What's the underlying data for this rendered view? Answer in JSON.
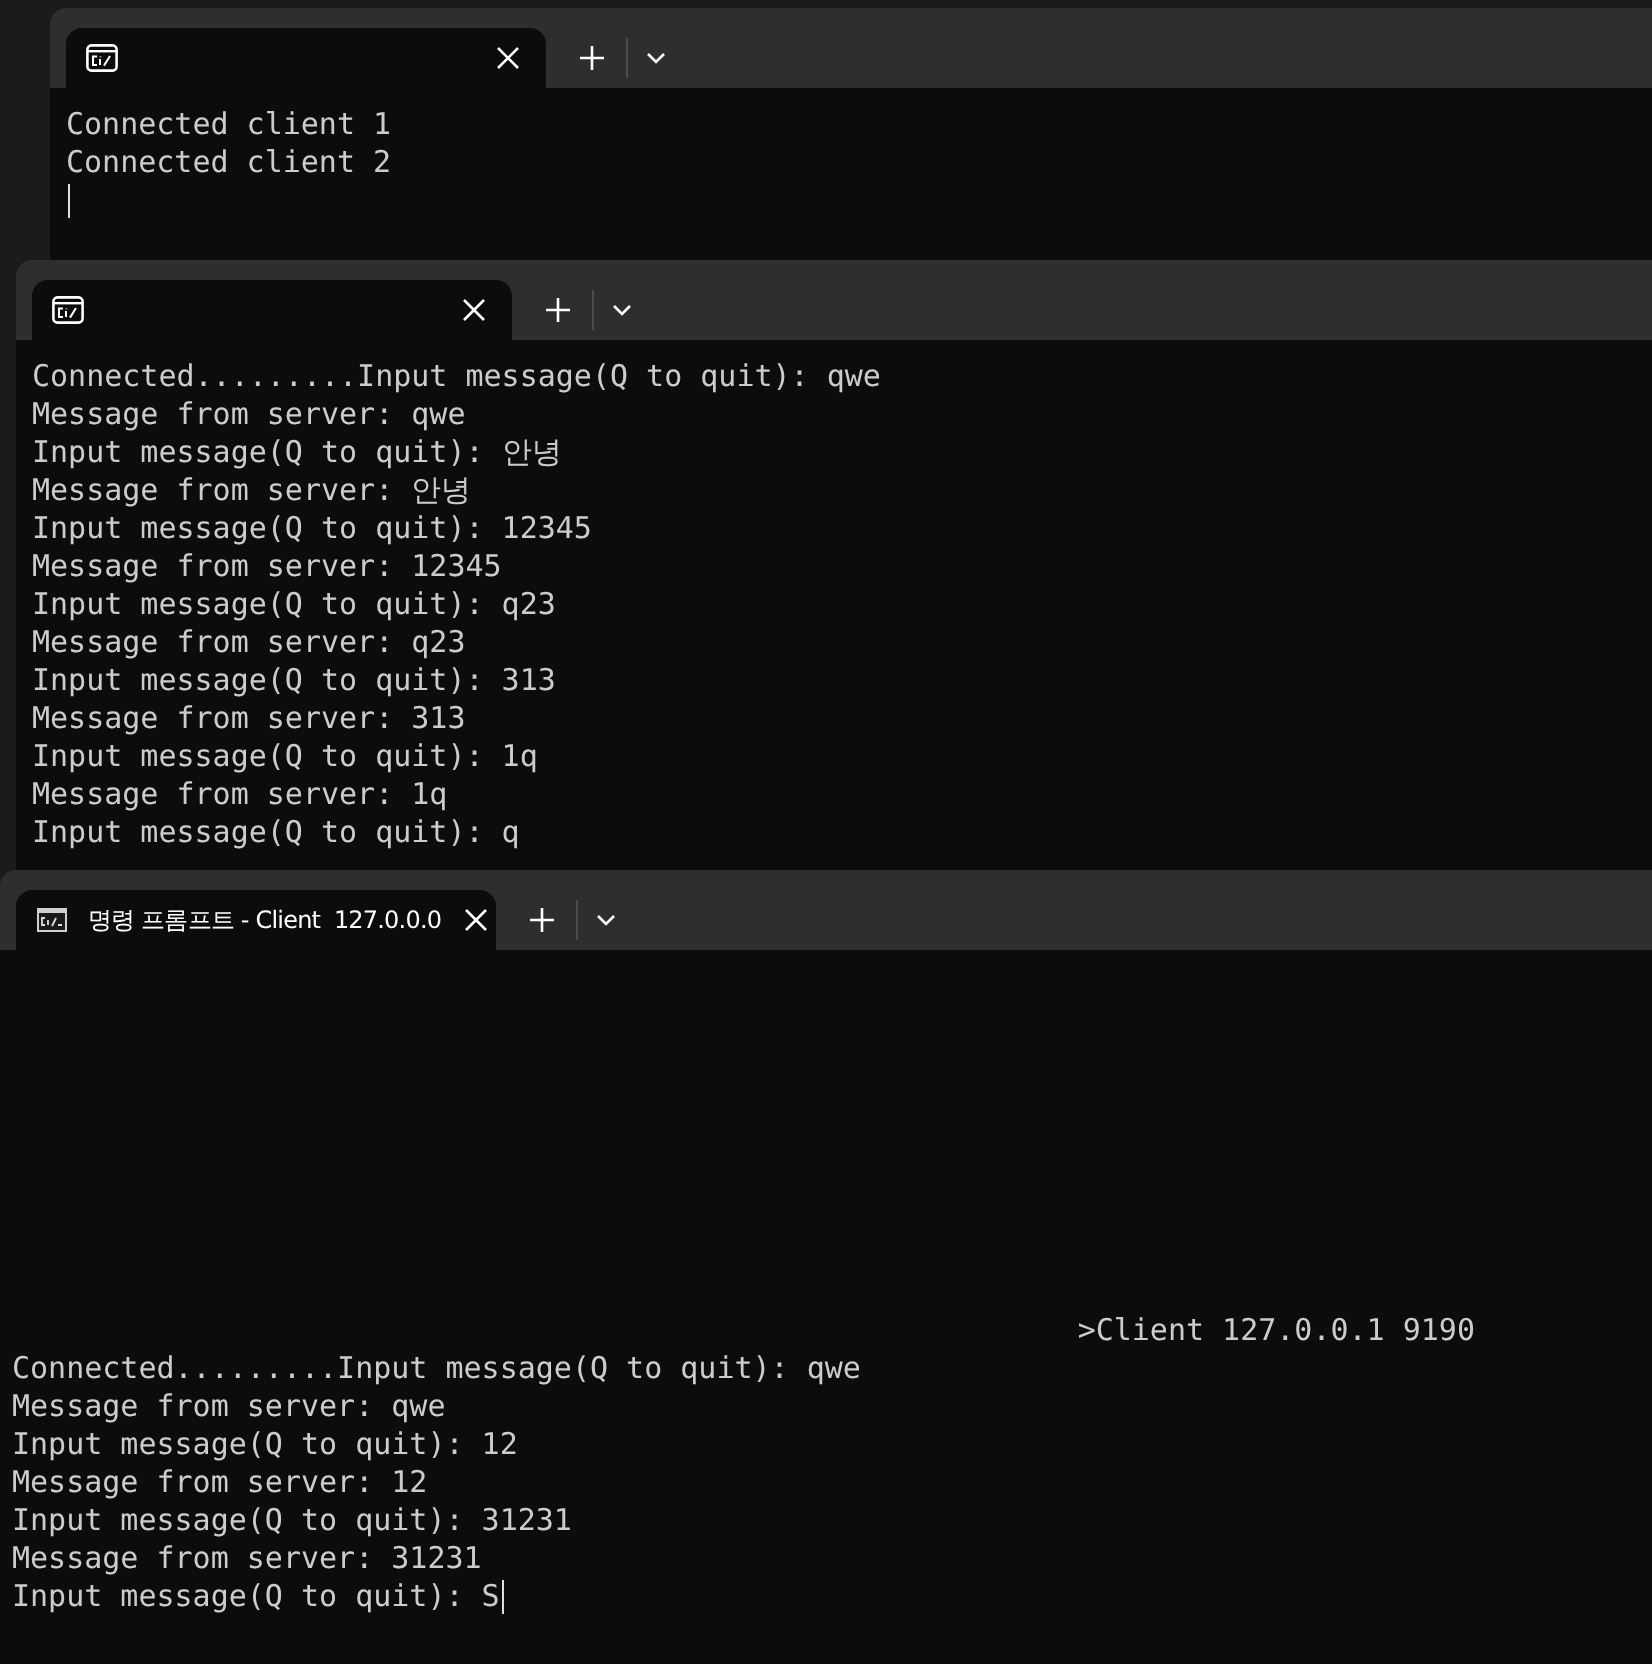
{
  "windows": [
    {
      "tab": {
        "selected": true
      },
      "lines": [
        {
          "kind": "output",
          "text": "Connected client 1",
          "cursor": false
        },
        {
          "kind": "output",
          "text": "Connected client 2",
          "cursor": false
        },
        {
          "kind": "blank",
          "cursor": true
        }
      ]
    },
    {
      "tab": {
        "selected": true
      },
      "lines": [
        {
          "kind": "output",
          "text": "Connected.........Input message(Q to quit): qwe",
          "cursor": false
        },
        {
          "kind": "output",
          "text": "Message from server: qwe",
          "cursor": false
        },
        {
          "kind": "output",
          "text": "Input message(Q to quit): 안녕",
          "cursor": false
        },
        {
          "kind": "output",
          "text": "Message from server: 안녕",
          "cursor": false
        },
        {
          "kind": "output",
          "text": "Input message(Q to quit): 12345",
          "cursor": false
        },
        {
          "kind": "output",
          "text": "Message from server: 12345",
          "cursor": false
        },
        {
          "kind": "output",
          "text": "Input message(Q to quit): q23",
          "cursor": false
        },
        {
          "kind": "output",
          "text": "Message from server: q23",
          "cursor": false
        },
        {
          "kind": "output",
          "text": "Input message(Q to quit): 313",
          "cursor": false
        },
        {
          "kind": "output",
          "text": "Message from server: 313",
          "cursor": false
        },
        {
          "kind": "output",
          "text": "Input message(Q to quit): 1q",
          "cursor": false
        },
        {
          "kind": "output",
          "text": "Message from server: 1q",
          "cursor": false
        },
        {
          "kind": "output",
          "text": "Input message(Q to quit): q",
          "cursor": false
        }
      ]
    },
    {
      "tab": {
        "title": "명령 프롬프트 - Client  127.0.0.0",
        "selected": true
      },
      "lines": [
        {
          "kind": "command",
          "text": ">Client 127.0.0.1 9190",
          "cursor": false
        },
        {
          "kind": "output",
          "text": "Connected.........Input message(Q to quit): qwe",
          "cursor": false
        },
        {
          "kind": "output",
          "text": "Message from server: qwe",
          "cursor": false
        },
        {
          "kind": "output",
          "text": "Input message(Q to quit): 12",
          "cursor": false
        },
        {
          "kind": "output",
          "text": "Message from server: 12",
          "cursor": false
        },
        {
          "kind": "output",
          "text": "Input message(Q to quit): 31231",
          "cursor": false
        },
        {
          "kind": "output",
          "text": "Message from server: 31231",
          "cursor": false
        },
        {
          "kind": "output",
          "text": "Input message(Q to quit): S",
          "cursor": true
        }
      ]
    }
  ]
}
